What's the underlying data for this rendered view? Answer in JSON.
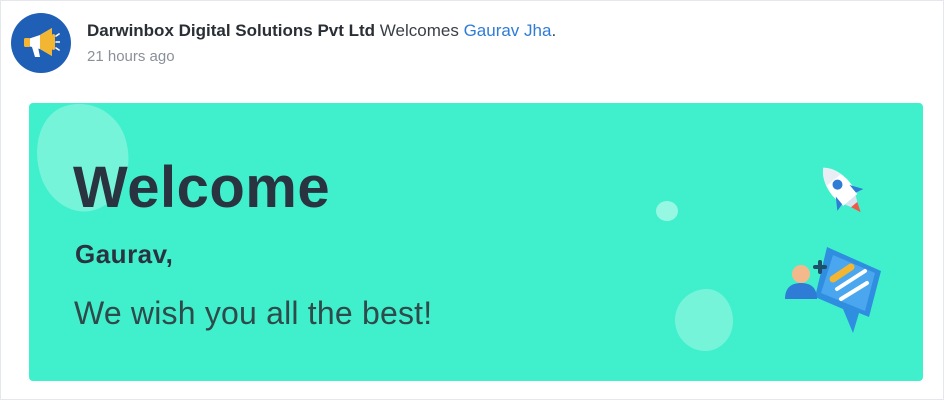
{
  "post": {
    "company_name": "Darwinbox Digital Solutions Pvt Ltd",
    "action_text": " Welcomes ",
    "employee_name": "Gaurav Jha",
    "trailing_punctuation": ".",
    "timestamp": "21 hours ago",
    "avatar_icon": "megaphone-icon",
    "avatar_color": "#1f5fb6"
  },
  "banner": {
    "title": "Welcome",
    "greeting_name": "Gaurav,",
    "message": "We wish you all the best!",
    "background_color": "#40f0cc",
    "illustrations": [
      "rocket-icon",
      "add-team-member-icon"
    ]
  },
  "colors": {
    "link": "#2f7cd6",
    "text_dark": "#2a3340",
    "text_muted": "#8a9099"
  }
}
